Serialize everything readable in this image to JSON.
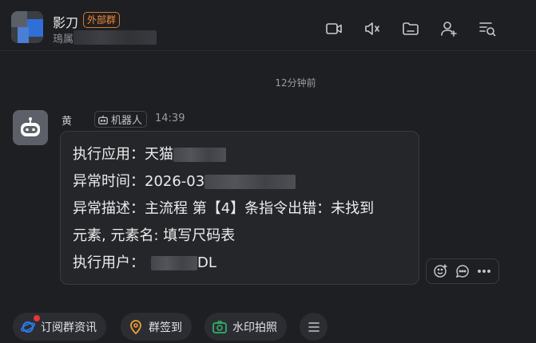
{
  "header": {
    "group_name": "影刀",
    "external_badge": "外部群",
    "subtitle_visible": "鳿属",
    "icons": [
      "video-call-icon",
      "speaker-icon",
      "folder-icon",
      "add-member-icon",
      "search-history-icon"
    ]
  },
  "timestamp_separator": "12分钟前",
  "message": {
    "sender": "黄",
    "robot_tag": "机器人",
    "time": "14:39",
    "lines": {
      "app_label": "执行应用：天猫",
      "time_label": "异常时间：2026-03",
      "desc_label": "异常描述：主流程 第【4】条指令出错：未找到",
      "desc_cont": "元素, 元素名: 填写尺码表",
      "user_label": "执行用户：",
      "user_suffix": "DL"
    }
  },
  "bottom_bar": {
    "subscribe": "订阅群资讯",
    "checkin": "群签到",
    "watermark_photo": "水印拍照"
  },
  "colors": {
    "background": "#1e1f22",
    "bubble": "#25262a",
    "badge_orange": "#ef8a3a",
    "notify_red": "#e8343a"
  }
}
